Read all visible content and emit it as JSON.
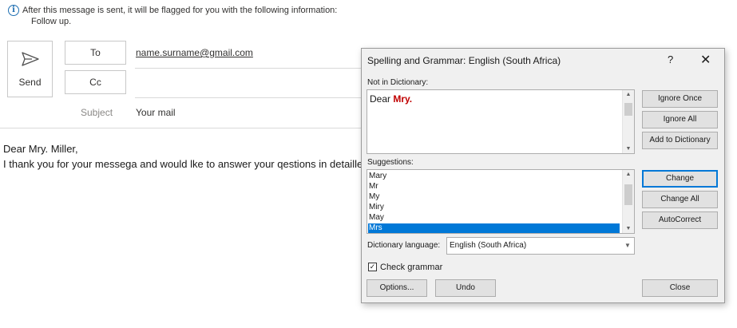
{
  "infobar": {
    "icon": "info-icon",
    "icon_glyph": "i",
    "message": "After this message is sent, it will be flagged for you with the following information:",
    "detail": "Follow up."
  },
  "compose": {
    "send_label": "Send",
    "to_label": "To",
    "cc_label": "Cc",
    "to_value": "name.surname@gmail.com",
    "subject_label": "Subject",
    "subject_value": "Your mail"
  },
  "body": {
    "line1": "Dear Mry. Miller,",
    "line2": "I thank you for your messega and would lke to answer your qestions in detaille"
  },
  "dialog": {
    "title": "Spelling and Grammar: English (South Africa)",
    "help_glyph": "?",
    "close_glyph": "✕",
    "not_in_dict_label": "Not in Dictionary:",
    "not_in_dict_prefix": "Dear ",
    "not_in_dict_error": "Mry.",
    "suggestions_label": "Suggestions:",
    "suggestions": [
      "Mary",
      "Mr",
      "My",
      "Miry",
      "May",
      "Mrs"
    ],
    "selected_suggestion": "Mrs",
    "dict_lang_label": "Dictionary language:",
    "dict_lang_value": "English (South Africa)",
    "check_grammar_label": "Check grammar",
    "check_grammar_checked": true,
    "buttons": {
      "ignore_once": "Ignore Once",
      "ignore_all": "Ignore All",
      "add_to_dictionary": "Add to Dictionary",
      "change": "Change",
      "change_all": "Change All",
      "autocorrect": "AutoCorrect",
      "options": "Options...",
      "undo": "Undo",
      "close": "Close"
    }
  },
  "colors": {
    "accent": "#0078d7",
    "error_text": "#c00000",
    "info_icon": "#1f6fb2"
  }
}
